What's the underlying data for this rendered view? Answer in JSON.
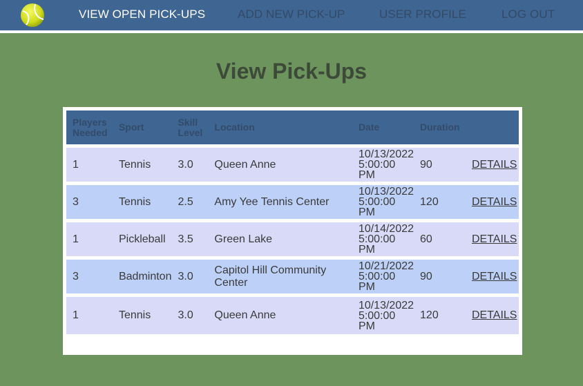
{
  "nav": {
    "logo_icon": "tennis-ball-icon",
    "view_open": "VIEW OPEN PICK-UPS",
    "add_new": "ADD NEW PICK-UP",
    "user_profile": "USER PROFILE",
    "log_out": "LOG OUT"
  },
  "page": {
    "title": "View Pick-Ups"
  },
  "table": {
    "headers": {
      "players_needed": "Players Needed",
      "sport": "Sport",
      "skill_level": "Skill Level",
      "location": "Location",
      "date": "Date",
      "duration": "Duration"
    },
    "rows": [
      {
        "players": "1",
        "sport": "Tennis",
        "skill": "3.0",
        "location": "Queen Anne",
        "date": "10/13/2022",
        "time": "5:00:00 PM",
        "duration": "90",
        "details": "DETAILS"
      },
      {
        "players": "3",
        "sport": "Tennis",
        "skill": "2.5",
        "location": "Amy Yee Tennis Center",
        "date": "10/13/2022",
        "time": "5:00:00 PM",
        "duration": "120",
        "details": "DETAILS"
      },
      {
        "players": "1",
        "sport": "Pickleball",
        "skill": "3.5",
        "location": "Green Lake",
        "date": "10/14/2022",
        "time": "5:00:00 PM",
        "duration": "60",
        "details": "DETAILS"
      },
      {
        "players": "3",
        "sport": "Badminton",
        "skill": "3.0",
        "location": "Capitol Hill Community Center",
        "date": "10/21/2022",
        "time": "5:00:00 PM",
        "duration": "90",
        "details": "DETAILS"
      },
      {
        "players": "1",
        "sport": "Tennis",
        "skill": "3.0",
        "location": "Queen Anne",
        "date": "10/13/2022",
        "time": "5:00:00 PM",
        "duration": "120",
        "details": "DETAILS"
      }
    ]
  },
  "colors": {
    "background": "#6d945c",
    "navbar": "#3f6592",
    "row_odd": "#d9daf8",
    "row_even": "#bdd0f7",
    "tennis_ball": "#d8e62a"
  }
}
